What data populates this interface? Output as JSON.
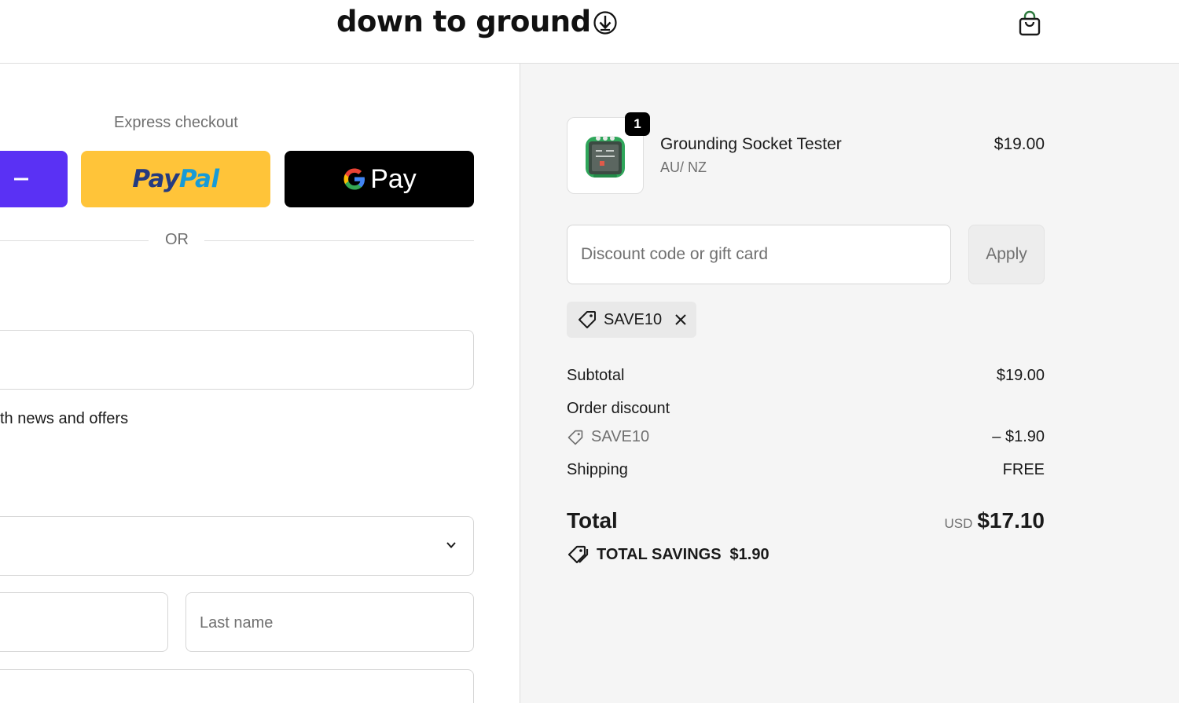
{
  "header": {
    "logo_text": "down to ground",
    "logo_icon": "arrow-down-circle-icon",
    "cart_icon": "shopping-bag-icon"
  },
  "checkout": {
    "express_label": "Express checkout",
    "buttons": [
      {
        "name": "shop-pay",
        "color": "#5a31f4"
      },
      {
        "name": "PayPal",
        "label_part1": "Pay",
        "label_part2": "Pal",
        "color": "#ffc439"
      },
      {
        "name": "Google Pay",
        "label": "Pay",
        "color": "#000000"
      }
    ],
    "or_label": "OR",
    "newsletter_text": "th news and offers",
    "last_name_placeholder": "Last name"
  },
  "order": {
    "item": {
      "title": "Grounding Socket Tester",
      "variant": "AU/ NZ",
      "price": "$19.00",
      "quantity": "1"
    },
    "discount_input_placeholder": "Discount code or gift card",
    "apply_label": "Apply",
    "applied_code": "SAVE10",
    "subtotal_label": "Subtotal",
    "subtotal_value": "$19.00",
    "order_discount_label": "Order discount",
    "discount_code": "SAVE10",
    "discount_value": "– $1.90",
    "shipping_label": "Shipping",
    "shipping_value": "FREE",
    "total_label": "Total",
    "currency": "USD",
    "total_value": "$17.10",
    "savings_label": "TOTAL SAVINGS",
    "savings_value": "$1.90"
  },
  "colors": {
    "sidebar_bg": "#f5f5f5",
    "paypal_blue_dark": "#253b80",
    "paypal_blue_light": "#179bd7",
    "product_green": "#2fa65a"
  }
}
